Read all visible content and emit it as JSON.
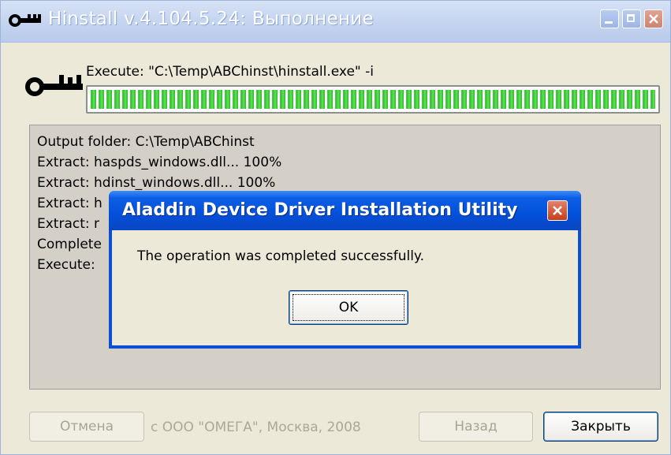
{
  "window": {
    "title": "Hinstall v.4.104.5.24:  Выполнение",
    "icon": "key-icon"
  },
  "progress": {
    "label": "Execute: \"C:\\Temp\\ABChinst\\hinstall.exe\" -i",
    "fraction": 1.0,
    "color": "#3fd13a"
  },
  "log": {
    "lines": [
      "Output folder: C:\\Temp\\ABChinst",
      "Extract: haspds_windows.dll... 100%",
      "Extract: hdinst_windows.dll... 100%",
      "Extract: h",
      "Extract: r",
      "Complete",
      "Execute:"
    ]
  },
  "footer": {
    "cancel_label": "Отмена",
    "copyright": "c ООО \"ОМЕГА\", Москва, 2008",
    "back_label": "Назад",
    "close_label": "Закрыть"
  },
  "dialog": {
    "title": "Aladdin Device Driver Installation Utility",
    "message": "The operation was completed successfully.",
    "ok_label": "OK"
  },
  "colors": {
    "dialog_title_blue": "#0350da",
    "window_bg": "#ece9d8",
    "log_bg": "#d4d0c8"
  }
}
